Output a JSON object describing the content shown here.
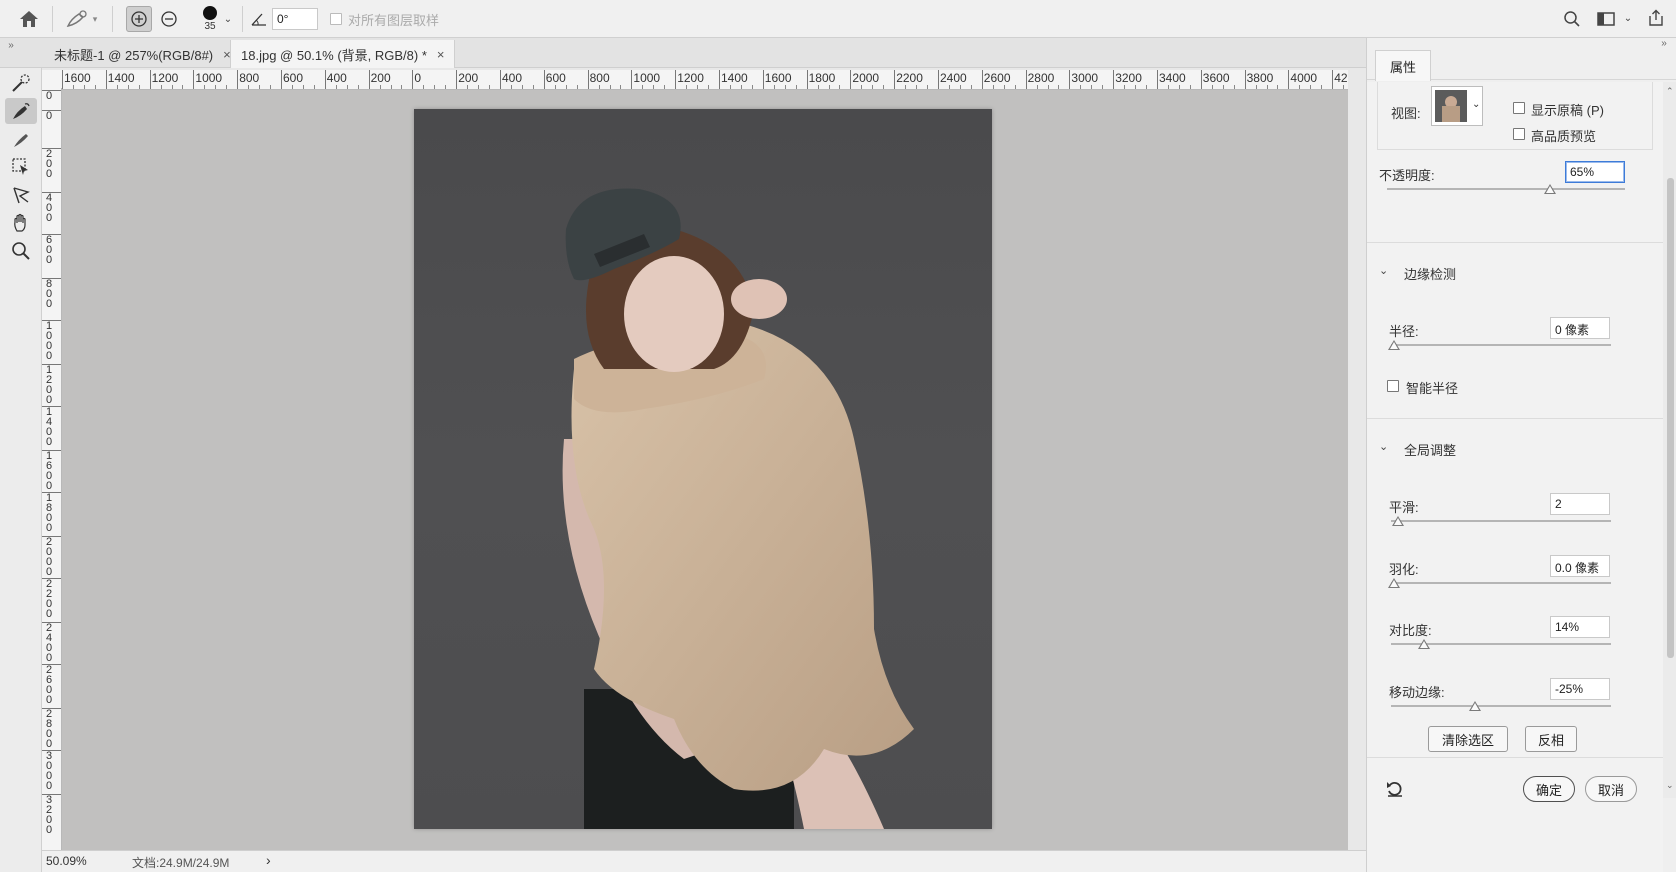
{
  "options_bar": {
    "brush_size": "35",
    "angle_value": "0°",
    "sample_all_layers_label": "对所有图层取样"
  },
  "tabs": [
    {
      "label": "未标题-1 @ 257%(RGB/8#)",
      "close": "×"
    },
    {
      "label": "18.jpg @ 50.1% (背景, RGB/8) *",
      "close": "×"
    }
  ],
  "ruler": {
    "h_labels": [
      "1600",
      "1400",
      "1200",
      "1000",
      "800",
      "600",
      "400",
      "200",
      "0",
      "200",
      "400",
      "600",
      "800",
      "1000",
      "1200",
      "1400",
      "1600",
      "1800",
      "2000",
      "2200",
      "2400",
      "2600",
      "2800",
      "3000",
      "3200",
      "3400",
      "3600",
      "3800",
      "4000",
      "42"
    ],
    "v_labels": [
      "0",
      "0",
      "200",
      "400",
      "600",
      "800",
      "1000",
      "1200",
      "1400",
      "1600",
      "1800",
      "2000",
      "2200",
      "2400",
      "2600",
      "2800",
      "3000",
      "3200"
    ]
  },
  "statusbar": {
    "zoom": "50.09%",
    "doc_info": "文档:24.9M/24.9M",
    "arrow": "›"
  },
  "panel": {
    "tab_label": "属性",
    "view_label": "视图:",
    "show_original_label": "显示原稿 (P)",
    "high_quality_label": "高品质预览",
    "opacity_label": "不透明度:",
    "opacity_value": "65%",
    "edge_detection_title": "边缘检测",
    "radius_label": "半径:",
    "radius_value": "0 像素",
    "smart_radius_label": "智能半径",
    "global_refine_title": "全局调整",
    "smooth_label": "平滑:",
    "smooth_value": "2",
    "feather_label": "羽化:",
    "feather_value": "0.0 像素",
    "contrast_label": "对比度:",
    "contrast_value": "14%",
    "shift_edge_label": "移动边缘:",
    "shift_edge_value": "-25%",
    "clear_selection_label": "清除选区",
    "invert_label": "反相",
    "ok_label": "确定",
    "cancel_label": "取消"
  },
  "colors": {
    "canvas_bg": "#c1c0bf",
    "photo_bg": "#4d4d4f",
    "focus_blue": "#3d7bd8"
  }
}
